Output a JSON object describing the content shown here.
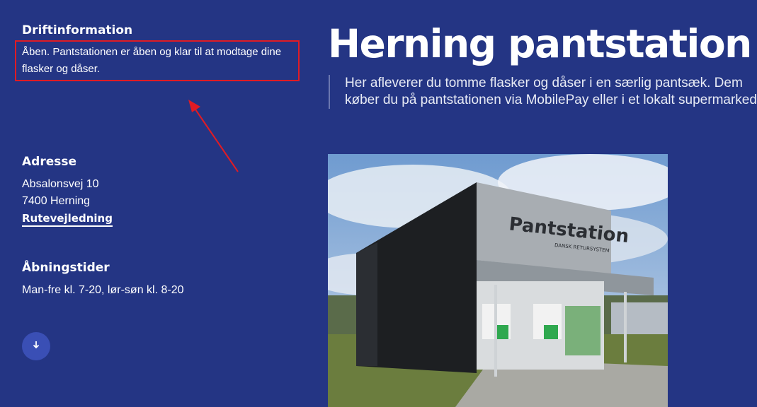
{
  "status": {
    "title": "Driftinformation",
    "text": "Åben. Pantstationen er åben og klar til at modtage dine flasker og dåser."
  },
  "address": {
    "title": "Adresse",
    "street": "Absalonsvej 10",
    "city": "7400 Herning",
    "directions_label": "Rutevejledning"
  },
  "hours": {
    "title": "Åbningstider",
    "text": "Man-fre kl. 7-20, lør-søn kl. 8-20"
  },
  "scroll_button": {
    "icon": "arrow-down-icon"
  },
  "main": {
    "title": "Herning pantstation",
    "intro": "Her afleverer du tomme flasker og dåser i en særlig pantsæk. Dem køber du på pantstationen via MobilePay eller i et lokalt supermarked."
  },
  "photo": {
    "sign_text": "Pantstation",
    "sign_subtext": "DANSK RETURSYSTEM"
  },
  "colors": {
    "background": "#243584",
    "highlight": "#e01b24",
    "button": "#3a4fb5"
  }
}
